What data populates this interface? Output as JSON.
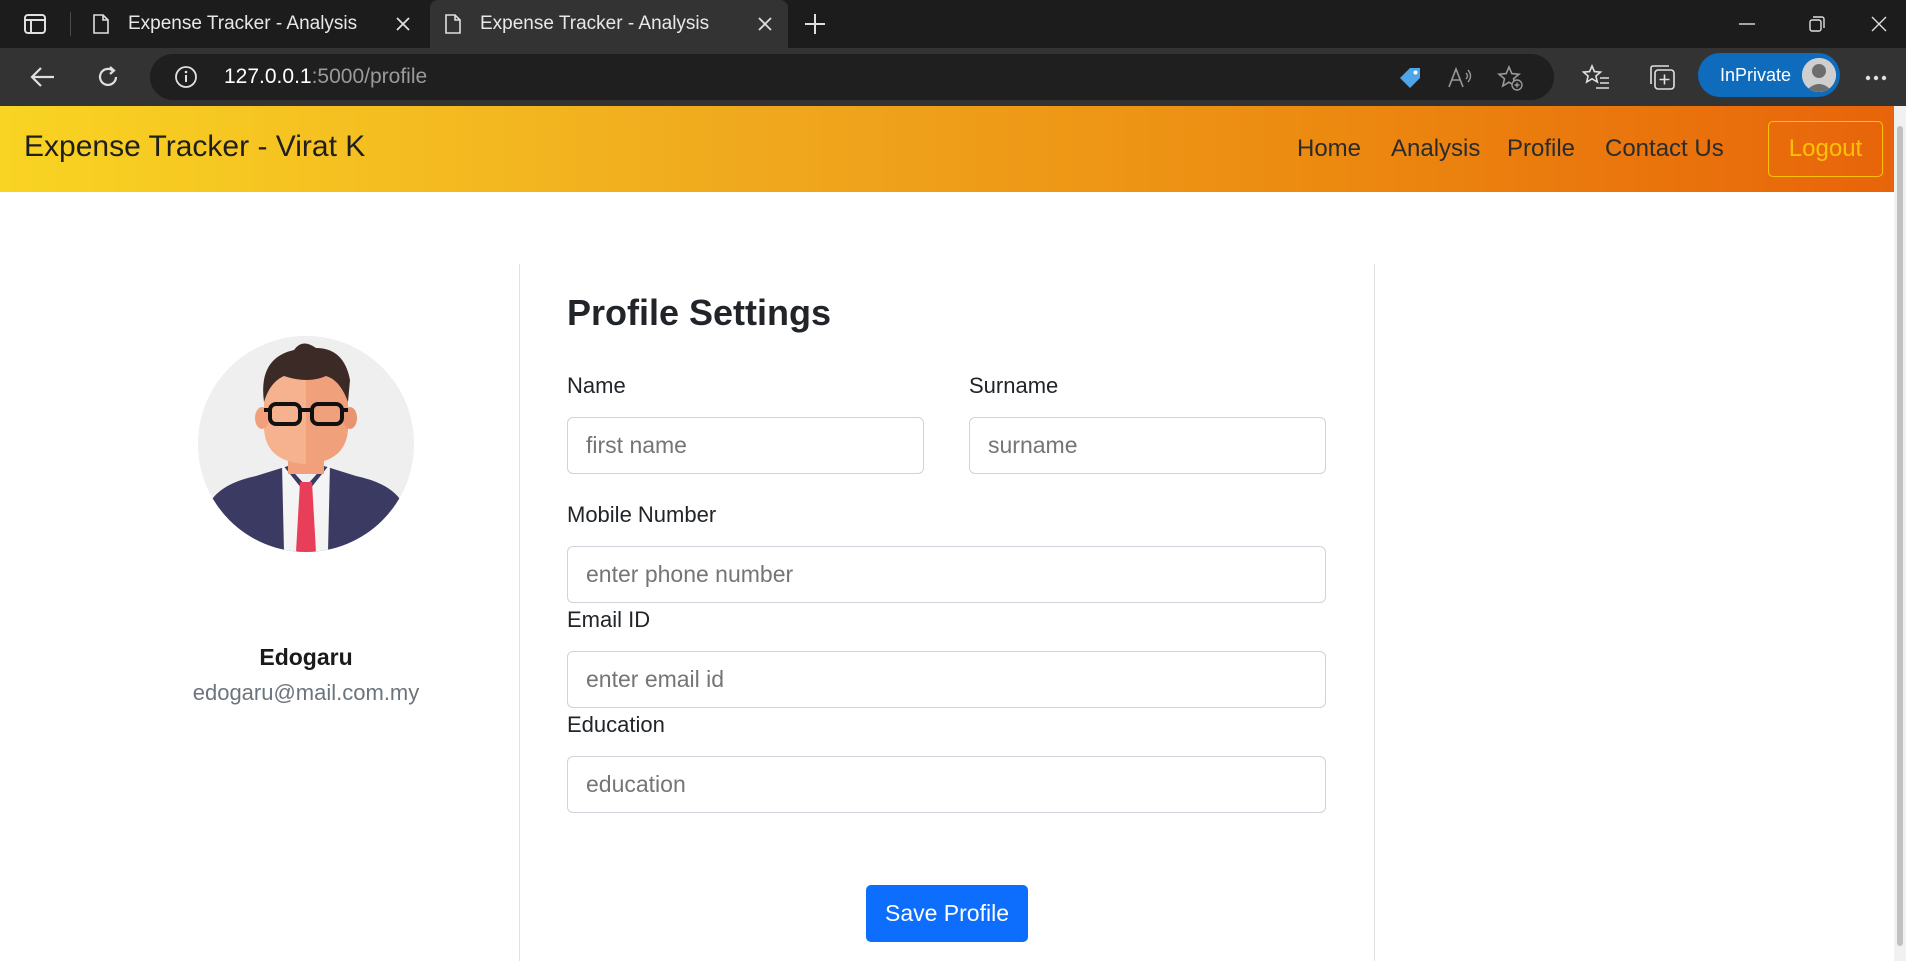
{
  "browser": {
    "tabs": [
      {
        "title": "Expense Tracker - Analysis"
      },
      {
        "title": "Expense Tracker - Analysis"
      }
    ],
    "address": {
      "host": "127.0.0.1",
      "path": ":5000/profile"
    },
    "inprivate_label": "InPrivate"
  },
  "navbar": {
    "brand": "Expense Tracker - Virat K",
    "links": {
      "home": "Home",
      "analysis": "Analysis",
      "profile": "Profile",
      "contact": "Contact Us"
    },
    "logout": "Logout"
  },
  "profile": {
    "name": "Edogaru",
    "email": "edogaru@mail.com.my"
  },
  "form": {
    "title": "Profile Settings",
    "name_label": "Name",
    "name_placeholder": "first name",
    "surname_label": "Surname",
    "surname_placeholder": "surname",
    "mobile_label": "Mobile Number",
    "mobile_placeholder": "enter phone number",
    "email_label": "Email ID",
    "email_placeholder": "enter email id",
    "education_label": "Education",
    "education_placeholder": "education",
    "save_label": "Save Profile"
  },
  "colors": {
    "navbar_gradient_start": "#f9d423",
    "navbar_gradient_end": "#e8640a",
    "logout": "#ffc107",
    "primary_button": "#0d6efd",
    "inprivate_badge": "#0f6cbd"
  }
}
